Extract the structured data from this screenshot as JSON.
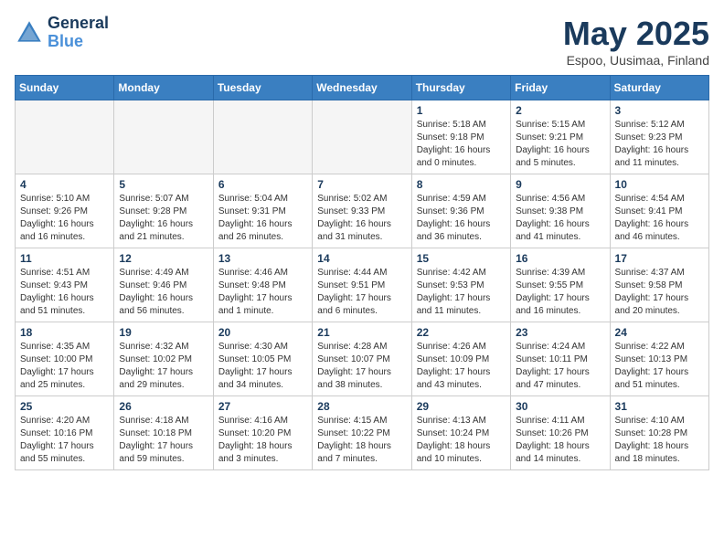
{
  "header": {
    "logo_line1": "General",
    "logo_line2": "Blue",
    "title": "May 2025",
    "subtitle": "Espoo, Uusimaa, Finland"
  },
  "weekdays": [
    "Sunday",
    "Monday",
    "Tuesday",
    "Wednesday",
    "Thursday",
    "Friday",
    "Saturday"
  ],
  "weeks": [
    [
      {
        "day": "",
        "info": ""
      },
      {
        "day": "",
        "info": ""
      },
      {
        "day": "",
        "info": ""
      },
      {
        "day": "",
        "info": ""
      },
      {
        "day": "1",
        "info": "Sunrise: 5:18 AM\nSunset: 9:18 PM\nDaylight: 16 hours\nand 0 minutes."
      },
      {
        "day": "2",
        "info": "Sunrise: 5:15 AM\nSunset: 9:21 PM\nDaylight: 16 hours\nand 5 minutes."
      },
      {
        "day": "3",
        "info": "Sunrise: 5:12 AM\nSunset: 9:23 PM\nDaylight: 16 hours\nand 11 minutes."
      }
    ],
    [
      {
        "day": "4",
        "info": "Sunrise: 5:10 AM\nSunset: 9:26 PM\nDaylight: 16 hours\nand 16 minutes."
      },
      {
        "day": "5",
        "info": "Sunrise: 5:07 AM\nSunset: 9:28 PM\nDaylight: 16 hours\nand 21 minutes."
      },
      {
        "day": "6",
        "info": "Sunrise: 5:04 AM\nSunset: 9:31 PM\nDaylight: 16 hours\nand 26 minutes."
      },
      {
        "day": "7",
        "info": "Sunrise: 5:02 AM\nSunset: 9:33 PM\nDaylight: 16 hours\nand 31 minutes."
      },
      {
        "day": "8",
        "info": "Sunrise: 4:59 AM\nSunset: 9:36 PM\nDaylight: 16 hours\nand 36 minutes."
      },
      {
        "day": "9",
        "info": "Sunrise: 4:56 AM\nSunset: 9:38 PM\nDaylight: 16 hours\nand 41 minutes."
      },
      {
        "day": "10",
        "info": "Sunrise: 4:54 AM\nSunset: 9:41 PM\nDaylight: 16 hours\nand 46 minutes."
      }
    ],
    [
      {
        "day": "11",
        "info": "Sunrise: 4:51 AM\nSunset: 9:43 PM\nDaylight: 16 hours\nand 51 minutes."
      },
      {
        "day": "12",
        "info": "Sunrise: 4:49 AM\nSunset: 9:46 PM\nDaylight: 16 hours\nand 56 minutes."
      },
      {
        "day": "13",
        "info": "Sunrise: 4:46 AM\nSunset: 9:48 PM\nDaylight: 17 hours\nand 1 minute."
      },
      {
        "day": "14",
        "info": "Sunrise: 4:44 AM\nSunset: 9:51 PM\nDaylight: 17 hours\nand 6 minutes."
      },
      {
        "day": "15",
        "info": "Sunrise: 4:42 AM\nSunset: 9:53 PM\nDaylight: 17 hours\nand 11 minutes."
      },
      {
        "day": "16",
        "info": "Sunrise: 4:39 AM\nSunset: 9:55 PM\nDaylight: 17 hours\nand 16 minutes."
      },
      {
        "day": "17",
        "info": "Sunrise: 4:37 AM\nSunset: 9:58 PM\nDaylight: 17 hours\nand 20 minutes."
      }
    ],
    [
      {
        "day": "18",
        "info": "Sunrise: 4:35 AM\nSunset: 10:00 PM\nDaylight: 17 hours\nand 25 minutes."
      },
      {
        "day": "19",
        "info": "Sunrise: 4:32 AM\nSunset: 10:02 PM\nDaylight: 17 hours\nand 29 minutes."
      },
      {
        "day": "20",
        "info": "Sunrise: 4:30 AM\nSunset: 10:05 PM\nDaylight: 17 hours\nand 34 minutes."
      },
      {
        "day": "21",
        "info": "Sunrise: 4:28 AM\nSunset: 10:07 PM\nDaylight: 17 hours\nand 38 minutes."
      },
      {
        "day": "22",
        "info": "Sunrise: 4:26 AM\nSunset: 10:09 PM\nDaylight: 17 hours\nand 43 minutes."
      },
      {
        "day": "23",
        "info": "Sunrise: 4:24 AM\nSunset: 10:11 PM\nDaylight: 17 hours\nand 47 minutes."
      },
      {
        "day": "24",
        "info": "Sunrise: 4:22 AM\nSunset: 10:13 PM\nDaylight: 17 hours\nand 51 minutes."
      }
    ],
    [
      {
        "day": "25",
        "info": "Sunrise: 4:20 AM\nSunset: 10:16 PM\nDaylight: 17 hours\nand 55 minutes."
      },
      {
        "day": "26",
        "info": "Sunrise: 4:18 AM\nSunset: 10:18 PM\nDaylight: 17 hours\nand 59 minutes."
      },
      {
        "day": "27",
        "info": "Sunrise: 4:16 AM\nSunset: 10:20 PM\nDaylight: 18 hours\nand 3 minutes."
      },
      {
        "day": "28",
        "info": "Sunrise: 4:15 AM\nSunset: 10:22 PM\nDaylight: 18 hours\nand 7 minutes."
      },
      {
        "day": "29",
        "info": "Sunrise: 4:13 AM\nSunset: 10:24 PM\nDaylight: 18 hours\nand 10 minutes."
      },
      {
        "day": "30",
        "info": "Sunrise: 4:11 AM\nSunset: 10:26 PM\nDaylight: 18 hours\nand 14 minutes."
      },
      {
        "day": "31",
        "info": "Sunrise: 4:10 AM\nSunset: 10:28 PM\nDaylight: 18 hours\nand 18 minutes."
      }
    ]
  ]
}
